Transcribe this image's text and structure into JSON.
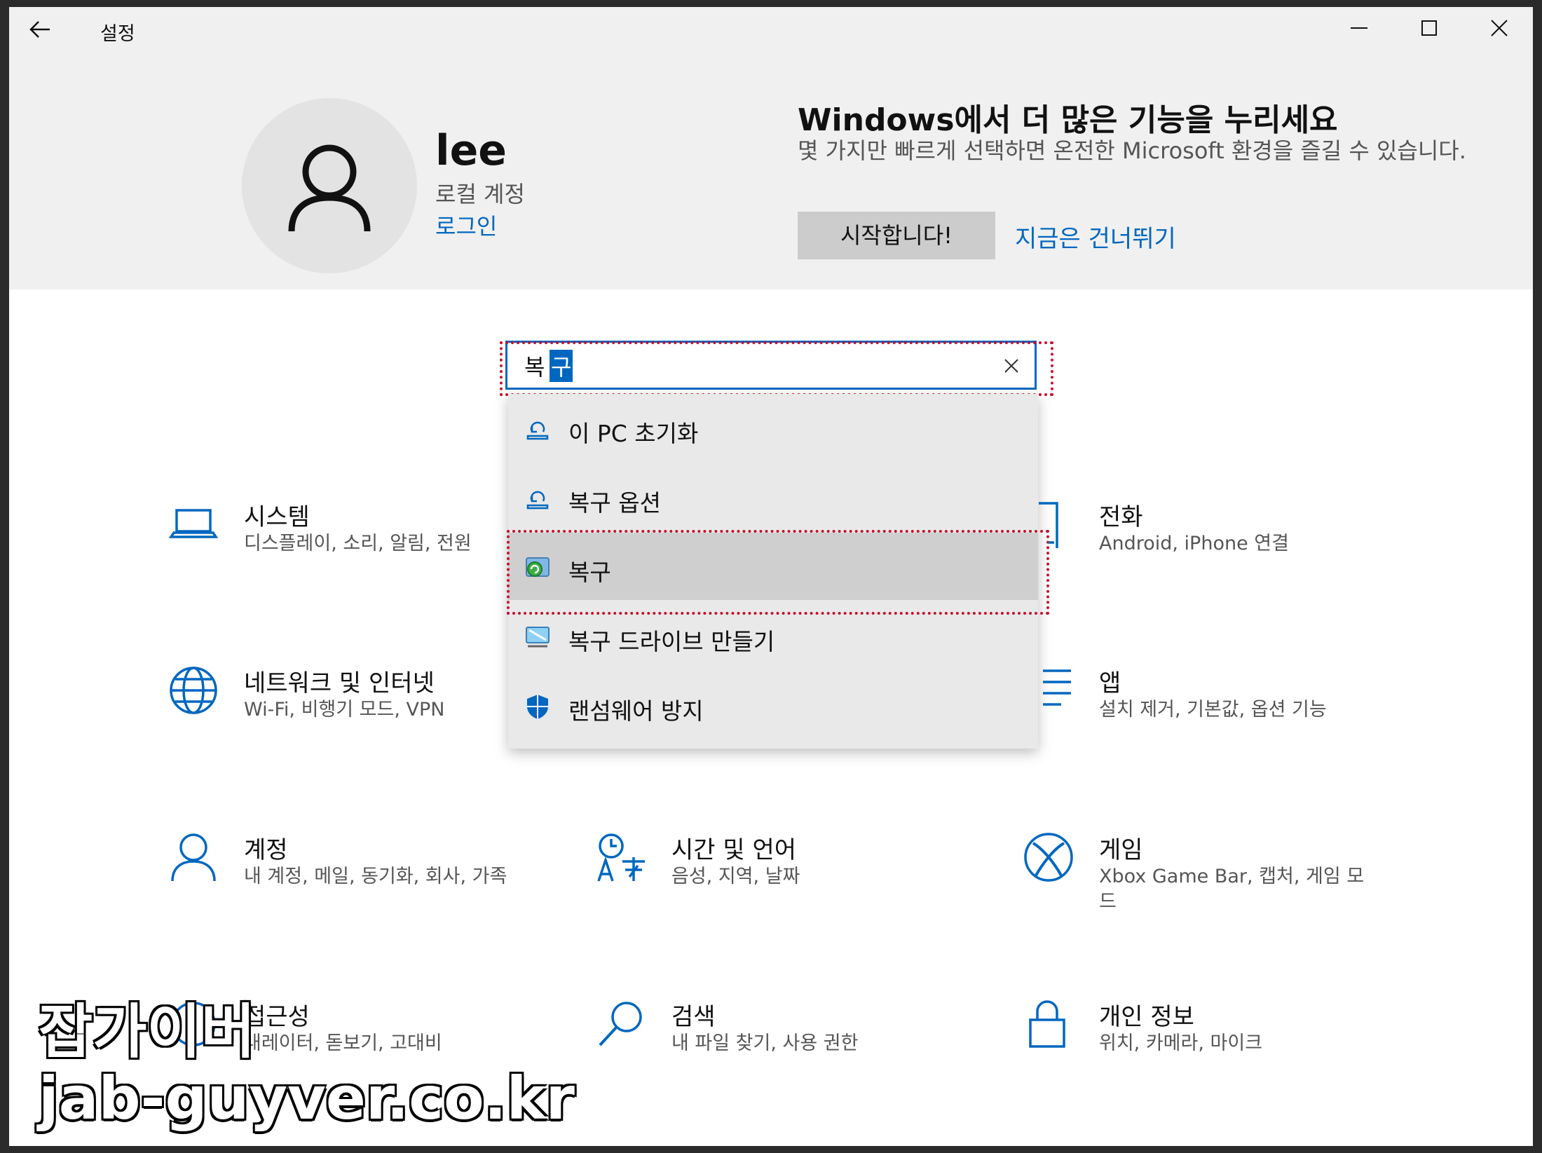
{
  "window": {
    "title": "설정"
  },
  "profile": {
    "name": "lee",
    "account_type": "로컬 계정",
    "signin_label": "로그인"
  },
  "promo": {
    "title": "Windows에서 더 많은 기능을 누리세요",
    "description": "몇 가지만 빠르게 선택하면 온전한 Microsoft 환경을 즐길 수 있습니다.",
    "start_label": "시작합니다!",
    "skip_label": "지금은 건너뛰기"
  },
  "search": {
    "value_unselected": "복",
    "value_selected": "구"
  },
  "suggestions": [
    {
      "label": "이 PC 초기화",
      "icon": "reset-pc-icon"
    },
    {
      "label": "복구 옵션",
      "icon": "recovery-options-icon"
    },
    {
      "label": "복구",
      "icon": "recovery-icon",
      "selected": true
    },
    {
      "label": "복구 드라이브 만들기",
      "icon": "recovery-drive-icon"
    },
    {
      "label": "랜섬웨어 방지",
      "icon": "shield-icon"
    }
  ],
  "tiles": {
    "system": {
      "title": "시스템",
      "desc": "디스플레이, 소리, 알림, 전원"
    },
    "phone": {
      "title": "전화",
      "desc": "Android, iPhone 연결"
    },
    "network": {
      "title": "네트워크 및 인터넷",
      "desc": "Wi-Fi, 비행기 모드, VPN"
    },
    "apps": {
      "title": "앱",
      "desc": "설치 제거, 기본값, 옵션 기능"
    },
    "accounts": {
      "title": "계정",
      "desc": "내 계정, 메일, 동기화, 회사, 가족"
    },
    "time": {
      "title": "시간 및 언어",
      "desc": "음성, 지역, 날짜"
    },
    "gaming": {
      "title": "게임",
      "desc": "Xbox Game Bar, 캡처, 게임 모드"
    },
    "accessibility": {
      "title": "접근성",
      "desc": "내레이터, 돋보기, 고대비"
    },
    "search": {
      "title": "검색",
      "desc": "내 파일 찾기, 사용 권한"
    },
    "privacy": {
      "title": "개인 정보",
      "desc": "위치, 카메라, 마이크"
    }
  },
  "watermark": {
    "line1": "잡가이버",
    "line2": "jab-guyver.co.kr"
  },
  "colors": {
    "accent": "#0067c0",
    "highlight": "#c8102e"
  }
}
